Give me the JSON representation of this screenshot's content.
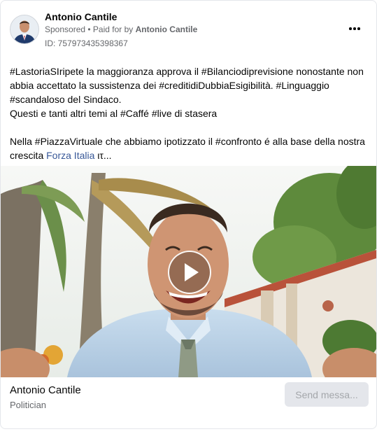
{
  "header": {
    "advertiser_name": "Antonio Cantile",
    "sponsored_label": "Sponsored",
    "separator": " • ",
    "paid_for_prefix": "Paid for by ",
    "paid_for_name": "Antonio Cantile",
    "ad_id": "ID: 757973435398367",
    "more_icon": "more-horizontal-icon"
  },
  "post": {
    "line1": "#LastoriaSIripete la maggioranza approva il #Bilanciodiprevisione nonostante non abbia accettato la sussistenza dei #creditidiDubbiaEsigibilità. #Linguaggio #scandaloso del Sindaco.",
    "line2": "Questi e tanti altri temi al #Caffé #live di stasera",
    "line3_text": "Nella #PiazzaVirtuale che abbiamo ipotizzato il #confronto é alla base della nostra crescita ",
    "line3_link": "Forza Italia",
    "line3_tail": " ιτ..."
  },
  "media": {
    "play_icon": "play-icon"
  },
  "footer": {
    "page_name": "Antonio Cantile",
    "category": "Politician",
    "send_button_label": "Send messa..."
  },
  "colors": {
    "link": "#385898",
    "secondary_text": "#65676b",
    "button_bg": "#e4e6eb",
    "button_text": "#a4a7ab"
  }
}
